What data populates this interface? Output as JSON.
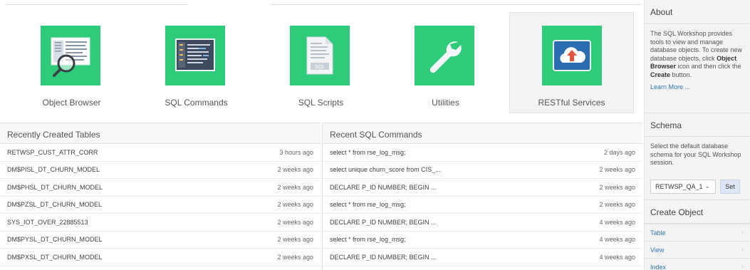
{
  "tiles": [
    {
      "label": "Object Browser",
      "icon": "object-browser-icon"
    },
    {
      "label": "SQL Commands",
      "icon": "sql-commands-icon"
    },
    {
      "label": "SQL Scripts",
      "icon": "sql-scripts-icon"
    },
    {
      "label": "Utilities",
      "icon": "wrench-icon"
    },
    {
      "label": "RESTful Services",
      "icon": "cloud-upload-icon"
    }
  ],
  "tables": {
    "title": "Recently Created Tables",
    "rows": [
      {
        "name": "RETWSP_CUST_ATTR_CORR",
        "age": "3 hours ago"
      },
      {
        "name": "DM$PISL_DT_CHURN_MODEL",
        "age": "2 weeks ago"
      },
      {
        "name": "DM$PHSL_DT_CHURN_MODEL",
        "age": "2 weeks ago"
      },
      {
        "name": "DM$PZSL_DT_CHURN_MODEL",
        "age": "2 weeks ago"
      },
      {
        "name": "SYS_IOT_OVER_22885513",
        "age": "2 weeks ago"
      },
      {
        "name": "DM$PYSL_DT_CHURN_MODEL",
        "age": "2 weeks ago"
      },
      {
        "name": "DM$PXSL_DT_CHURN_MODEL",
        "age": "2 weeks ago"
      }
    ]
  },
  "commands": {
    "title": "Recent SQL Commands",
    "rows": [
      {
        "name": "select * from rse_log_msg;",
        "age": "2 days ago"
      },
      {
        "name": "select unique churn_score from CIS_...",
        "age": "2 weeks ago"
      },
      {
        "name": "DECLARE P_ID NUMBER; BEGIN ...",
        "age": "2 weeks ago"
      },
      {
        "name": "select * from rse_log_msg;",
        "age": "2 weeks ago"
      },
      {
        "name": "DECLARE P_ID NUMBER; BEGIN ...",
        "age": "4 weeks ago"
      },
      {
        "name": "select * from rse_log_msg;",
        "age": "4 weeks ago"
      },
      {
        "name": "DECLARE P_ID NUMBER; BEGIN ...",
        "age": "4 weeks ago"
      }
    ]
  },
  "sidebar": {
    "about_title": "About",
    "about_1": "The SQL Workshop provides tools to view and manage database objects. To create new database objects, click ",
    "about_b1": "Object Browser",
    "about_2": " icon and then click the ",
    "about_b2": "Create",
    "about_3": " button.",
    "learn_more": "Learn More ...",
    "schema_title": "Schema",
    "schema_text": "Select the default database schema for your SQL Workshop session.",
    "schema_value": "RETWSP_QA_1",
    "set_label": "Set",
    "create_title": "Create Object",
    "create_items": [
      "Table",
      "View",
      "Index"
    ]
  },
  "colors": {
    "tile_green": "#2ecc7a",
    "link_blue": "#2d76b8"
  }
}
